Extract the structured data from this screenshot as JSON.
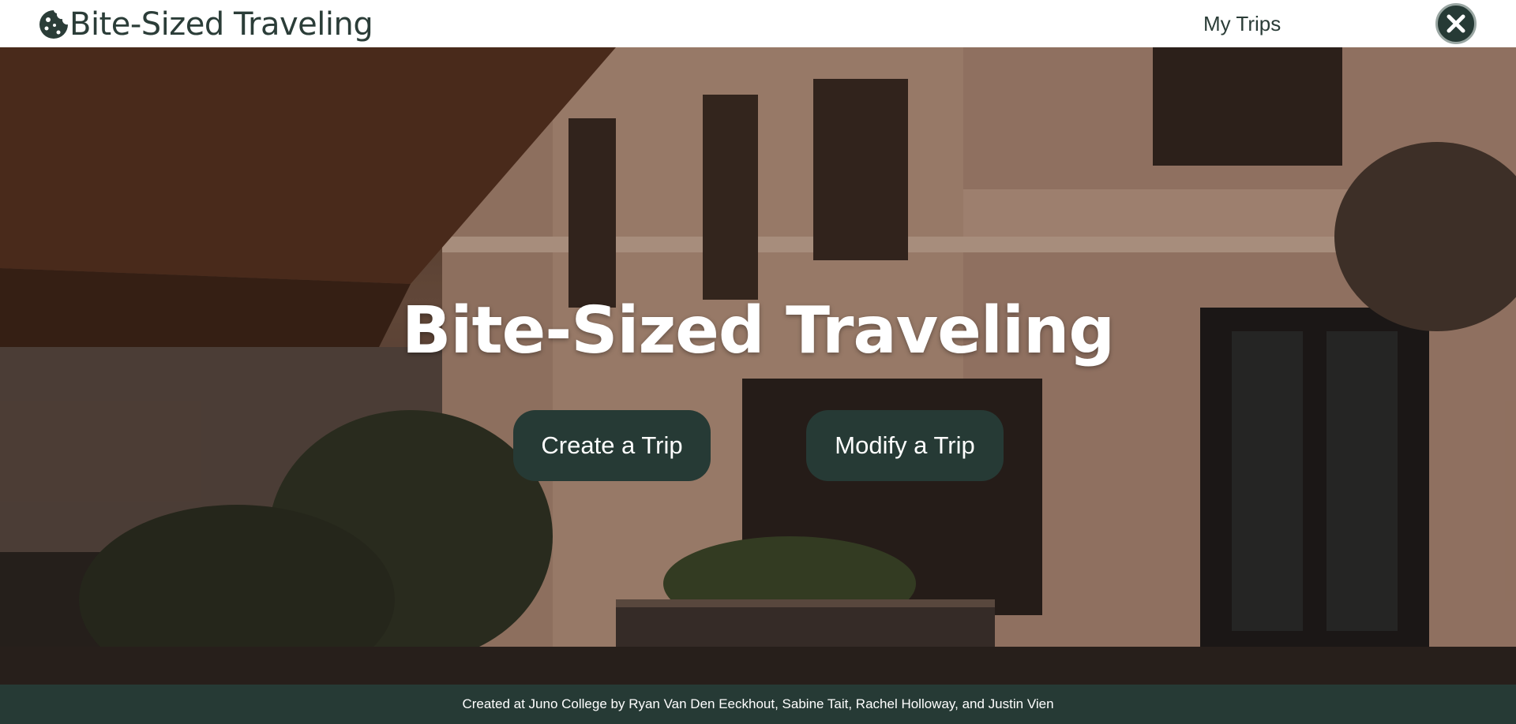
{
  "header": {
    "brand_text": "Bite-Sized Traveling",
    "nav_link": "My Trips"
  },
  "hero": {
    "title": "Bite-Sized Traveling",
    "create_button": "Create a Trip",
    "modify_button": "Modify a Trip"
  },
  "footer": {
    "credit": "Created at Juno College by Ryan Van Den Eeckhout, Sabine Tait, Rachel Holloway, and Justin Vien"
  },
  "icons": {
    "brand": "cookie-icon",
    "close": "close-icon"
  },
  "colors": {
    "primary_dark": "#263a35",
    "brand_text": "#2b3d38",
    "hero_text": "#ffffff"
  }
}
